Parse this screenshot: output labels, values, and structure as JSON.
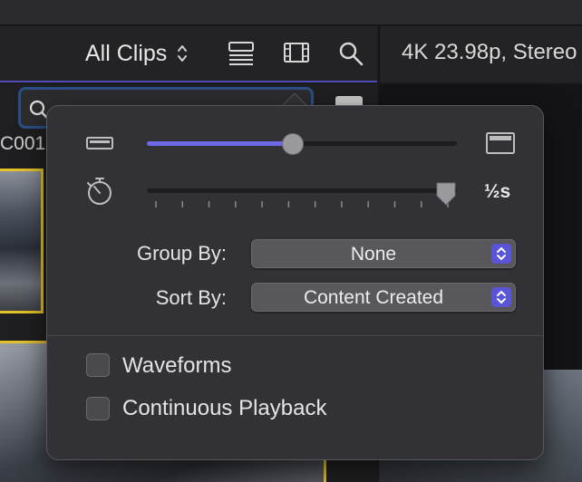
{
  "toolbar": {
    "clips_filter": "All Clips",
    "project_info": "4K 23.98p, Stereo"
  },
  "browser": {
    "search_placeholder": "Search",
    "clip_label": "C001"
  },
  "popover": {
    "clip_height_value": 0.47,
    "duration_label": "½s",
    "duration_value": 1.0,
    "group_by_label": "Group By:",
    "group_by_value": "None",
    "sort_by_label": "Sort By:",
    "sort_by_value": "Content Created",
    "waveforms_label": "Waveforms",
    "waveforms_checked": false,
    "continuous_playback_label": "Continuous Playback",
    "continuous_playback_checked": false
  },
  "colors": {
    "accent": "#5856d6",
    "selection_border": "#e2c12b"
  }
}
